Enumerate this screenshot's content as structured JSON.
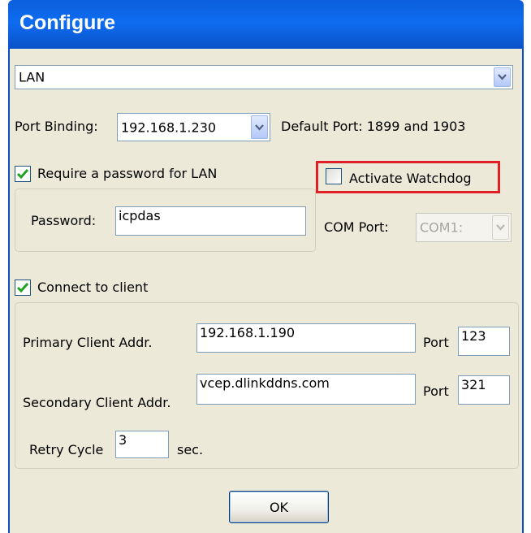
{
  "window": {
    "title": "Configure"
  },
  "connection_type": {
    "value": "LAN"
  },
  "port_binding": {
    "label": "Port Binding:",
    "value": "192.168.1.230",
    "default_port_text": "Default Port: 1899 and 1903"
  },
  "password_section": {
    "require_password_label": "Require a password for LAN",
    "require_password_checked": true,
    "password_label": "Password:",
    "password_value": "icpdas"
  },
  "watchdog": {
    "activate_label": "Activate Watchdog",
    "activate_checked": false,
    "com_port_label": "COM Port:",
    "com_port_value": "COM1:"
  },
  "client_section": {
    "connect_label": "Connect to client",
    "connect_checked": true,
    "primary_label": "Primary Client Addr.",
    "primary_value": "192.168.1.190",
    "primary_port_label": "Port",
    "primary_port_value": "123",
    "secondary_label": "Secondary Client Addr.",
    "secondary_value": "vcep.dlinkddns.com",
    "secondary_port_label": "Port",
    "secondary_port_value": "321",
    "retry_label": "Retry Cycle",
    "retry_value": "3",
    "retry_unit": "sec."
  },
  "buttons": {
    "ok_label": "OK"
  },
  "colors": {
    "titlebar": "#0f6cf0",
    "dialog_bg": "#ece9d8",
    "check_green": "#21a121",
    "highlight": "#e01f26"
  },
  "icons": {
    "dropdown": "chevron-down-icon",
    "check": "check-icon"
  }
}
